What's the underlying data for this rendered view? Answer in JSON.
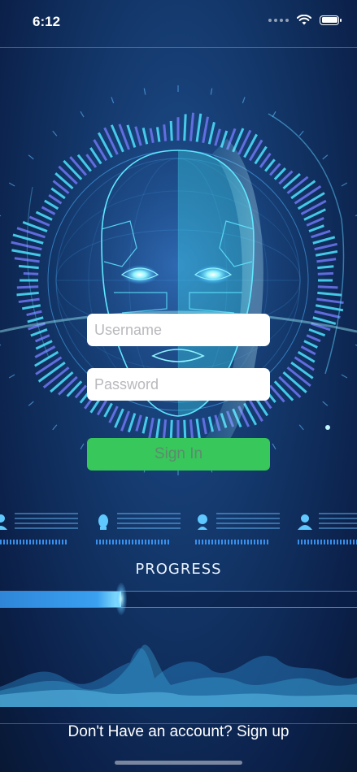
{
  "status_bar": {
    "time": "6:12",
    "icons": [
      "signal-icon",
      "wifi-icon",
      "battery-icon"
    ]
  },
  "form": {
    "username_placeholder": "Username",
    "password_placeholder": "Password",
    "signin_label": "Sign In"
  },
  "progress": {
    "label": "PROGRESS",
    "value": 0.34
  },
  "footer": {
    "signup_text": "Don't Have an account? Sign up"
  },
  "colors": {
    "background": "#123567",
    "accent_cyan": "#4fe3ff",
    "accent_purple": "#6e77f2",
    "button_green": "#37c75a"
  },
  "people_icons": [
    "person-icon",
    "person-icon",
    "person-icon",
    "person-icon"
  ]
}
